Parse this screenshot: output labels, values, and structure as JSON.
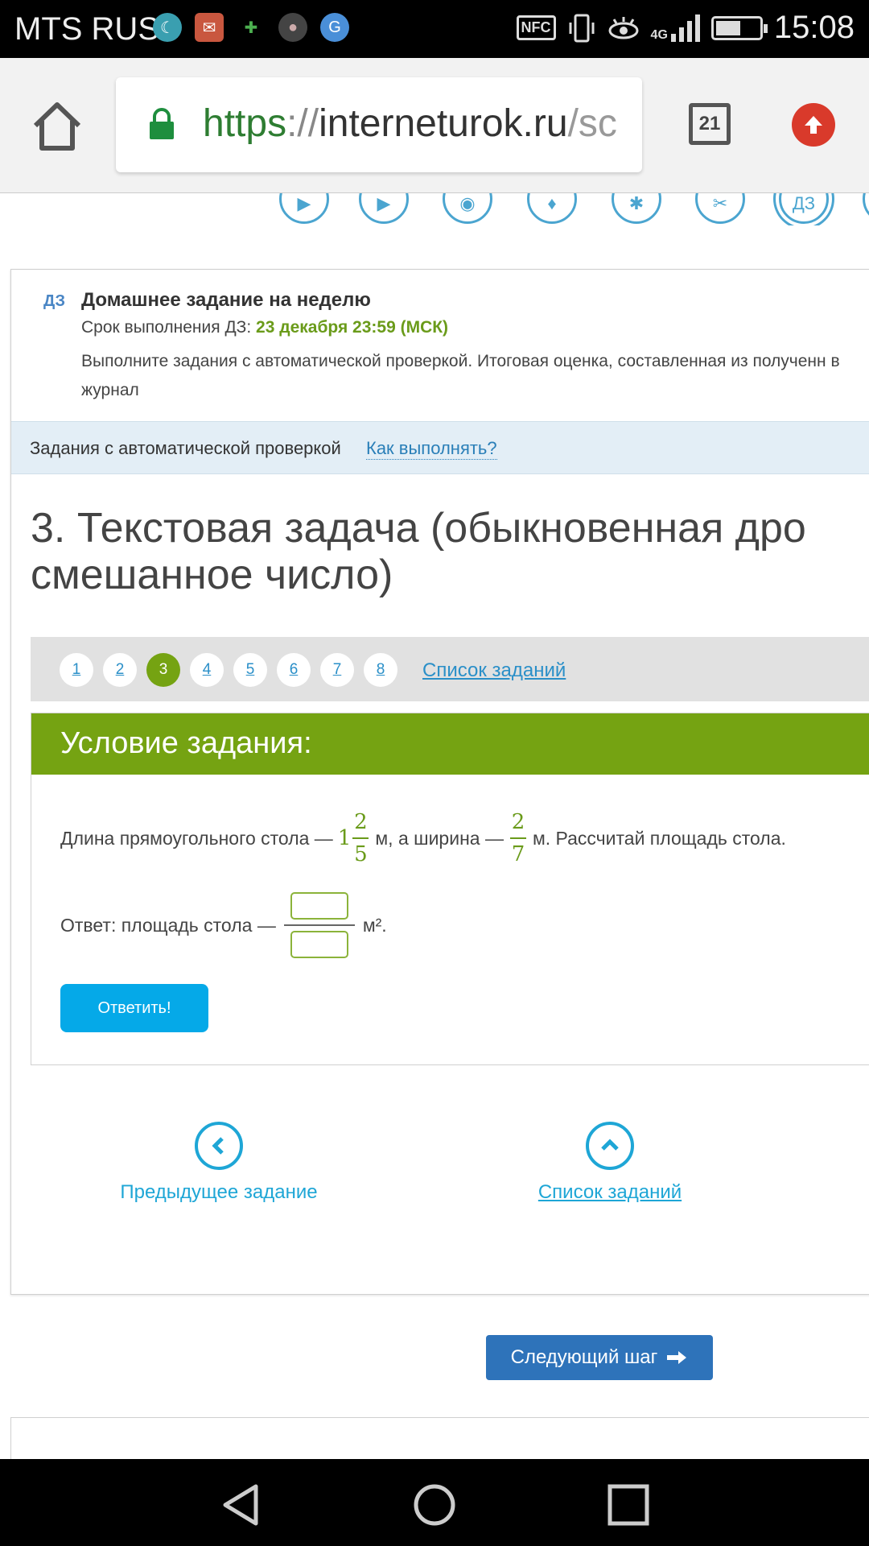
{
  "status": {
    "carrier": "MTS RUS",
    "nfc": "NFC",
    "network": "4G",
    "time": "15:08"
  },
  "browser": {
    "url_scheme": "https",
    "url_sep": "://",
    "url_host": "interneturok.ru",
    "url_path": "/sc",
    "tab_count": "21"
  },
  "lesson_steps": [
    "",
    "",
    "",
    "",
    "",
    "",
    "ДЗ",
    ""
  ],
  "homework": {
    "tag": "ДЗ",
    "title": "Домашнее задание на неделю",
    "deadline_label": "Срок выполнения ДЗ:",
    "deadline_value": "23 декабря 23:59 (МСК)",
    "description": "Выполните задания с автоматической проверкой. Итоговая оценка, составленная из полученн в журнал"
  },
  "autocheck": {
    "label": "Задания с автоматической проверкой",
    "how_link": "Как выполнять?"
  },
  "task": {
    "title_line1": "3. Текстовая задача (обыкновенная дро",
    "title_line2": "смешанное число)"
  },
  "pager": {
    "pages": [
      "1",
      "2",
      "3",
      "4",
      "5",
      "6",
      "7",
      "8"
    ],
    "active_index": 2,
    "list_link": "Список заданий"
  },
  "condition": {
    "header": "Условие задания:",
    "text_a": "Длина прямоугольного стола —",
    "length_whole": "1",
    "length_num": "2",
    "length_den": "5",
    "text_b": "м, а ширина —",
    "width_num": "2",
    "width_den": "7",
    "text_c": "м. Рассчитай площадь стола.",
    "answer_label": "Ответ: площадь стола —",
    "answer_unit": "м².",
    "submit_label": "Ответить!"
  },
  "navigation": {
    "prev_label": "Предыдущее задание",
    "list_label": "Список заданий",
    "next_step_label": "Следующий шаг"
  },
  "colors": {
    "accent_green": "#75a312",
    "link_blue": "#2a8fc8",
    "submit_blue": "#05a9e8",
    "next_blue": "#2e73ba"
  }
}
